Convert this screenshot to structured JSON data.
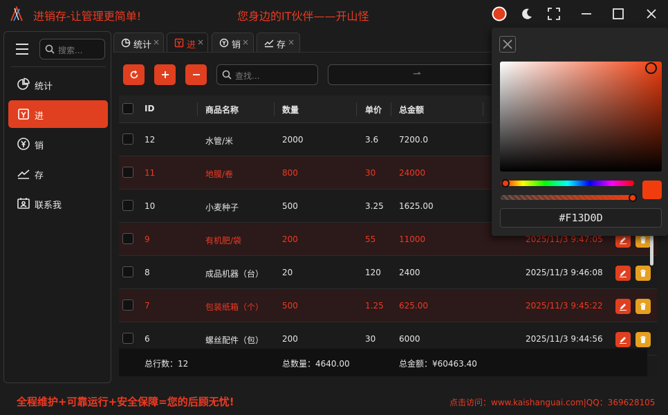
{
  "titlebar": {
    "app_title": "进销存-让管理更简单!",
    "slogan": "您身边的IT伙伴——开山怪"
  },
  "sidebar": {
    "search_placeholder": "搜索...",
    "items": [
      {
        "label": "统计",
        "icon": "pie-chart-icon"
      },
      {
        "label": "进",
        "icon": "inbound-icon",
        "active": true
      },
      {
        "label": "销",
        "icon": "yen-icon"
      },
      {
        "label": "存",
        "icon": "trend-icon"
      },
      {
        "label": "联系我",
        "icon": "contact-card-icon"
      }
    ]
  },
  "tabs": [
    {
      "label": "统计",
      "icon": "pie-chart-icon"
    },
    {
      "label": "进",
      "icon": "inbound-icon",
      "active": true
    },
    {
      "label": "销",
      "icon": "yen-icon"
    },
    {
      "label": "存",
      "icon": "trend-icon"
    }
  ],
  "toolbar": {
    "search_placeholder": "查找...",
    "date_separator": "⇀"
  },
  "table": {
    "columns": [
      "ID",
      "商品名称",
      "数量",
      "单价",
      "总金额"
    ],
    "rows": [
      {
        "id": "12",
        "name": "水管/米",
        "qty": "2000",
        "price": "3.6",
        "total": "7200.0",
        "time": "",
        "hl": false
      },
      {
        "id": "11",
        "name": "地膜/卷",
        "qty": "800",
        "price": "30",
        "total": "24000",
        "time": "",
        "hl": true
      },
      {
        "id": "10",
        "name": "小麦种子",
        "qty": "500",
        "price": "3.25",
        "total": "1625.00",
        "time": "",
        "hl": false
      },
      {
        "id": "9",
        "name": "有机肥/袋",
        "qty": "200",
        "price": "55",
        "total": "11000",
        "time": "2025/11/3 9:47:05",
        "hl": true
      },
      {
        "id": "8",
        "name": "成品机器（台）",
        "qty": "20",
        "price": "120",
        "total": "2400",
        "time": "2025/11/3 9:46:08",
        "hl": false
      },
      {
        "id": "7",
        "name": "包装纸箱（个）",
        "qty": "500",
        "price": "1.25",
        "total": "625.00",
        "time": "2025/11/3 9:45:22",
        "hl": true
      },
      {
        "id": "6",
        "name": "螺丝配件（包）",
        "qty": "200",
        "price": "30",
        "total": "6000",
        "time": "2025/11/3 9:44:56",
        "hl": false
      }
    ],
    "footer": {
      "rows": "总行数：12",
      "qty": "总数量：4640.00",
      "amount": "总金额：¥60463.40"
    }
  },
  "footer": {
    "left": "全程维护+可靠运行+安全保障=您的后顾无忧!",
    "right": "点击访问：www.kaishanguai.com|QQ：369628105"
  },
  "color_picker": {
    "hex": "#F13D0D"
  },
  "colors": {
    "accent": "#E0401F",
    "highlight_text": "#EE3A22",
    "delete": "#E6A020",
    "picked": "#F13D0D"
  }
}
